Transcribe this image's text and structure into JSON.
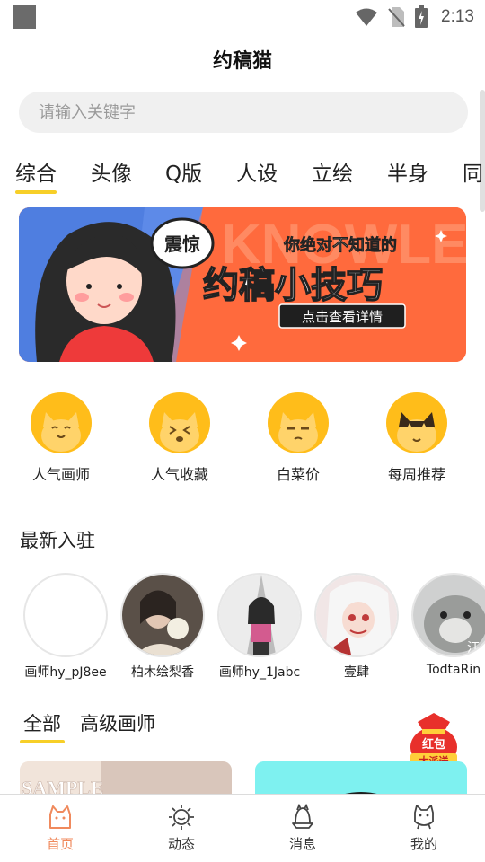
{
  "status_bar": {
    "time": "2:13"
  },
  "app": {
    "title": "约稿猫"
  },
  "search": {
    "placeholder": "请输入关键字"
  },
  "categories": [
    {
      "label": "综合",
      "active": true
    },
    {
      "label": "头像"
    },
    {
      "label": "Q版"
    },
    {
      "label": "人设"
    },
    {
      "label": "立绘"
    },
    {
      "label": "半身"
    },
    {
      "label": "同"
    }
  ],
  "banner": {
    "tag": "震惊",
    "subtitle": "你绝对不知道的",
    "title": "约稿小技巧",
    "button": "点击查看详情",
    "bg_text": "KNOWLEDGE ZHISHI"
  },
  "quick_entries": [
    {
      "label": "人气画师",
      "icon": "cat-smile-icon"
    },
    {
      "label": "人气收藏",
      "icon": "cat-dizzy-icon"
    },
    {
      "label": "白菜价",
      "icon": "cat-grumpy-icon"
    },
    {
      "label": "每周推荐",
      "icon": "cat-sparkle-icon"
    }
  ],
  "newest": {
    "title": "最新入驻",
    "items": [
      {
        "name": "画师hy_pJ8ee"
      },
      {
        "name": "柏木绘梨香"
      },
      {
        "name": "画师hy_1Jabc"
      },
      {
        "name": "壹肆"
      },
      {
        "name": "TodtaRin",
        "overlay": "汪"
      }
    ]
  },
  "filter_tabs": [
    {
      "label": "全部",
      "active": true
    },
    {
      "label": "高级画师"
    }
  ],
  "red_packet": {
    "line1": "红包",
    "line2": "大派送"
  },
  "cards": [
    {
      "watermark": "SAMPLE"
    },
    {}
  ],
  "bottom_nav": [
    {
      "label": "首页",
      "icon": "home-cat-icon",
      "active": true
    },
    {
      "label": "动态",
      "icon": "sun-cat-icon"
    },
    {
      "label": "消息",
      "icon": "bell-cat-icon"
    },
    {
      "label": "我的",
      "icon": "profile-cat-icon"
    }
  ],
  "colors": {
    "accent": "#f7cf28",
    "nav_active": "#f08a5d",
    "quick_bg": "#ffbd1a",
    "banner": "#ff6a3d"
  }
}
